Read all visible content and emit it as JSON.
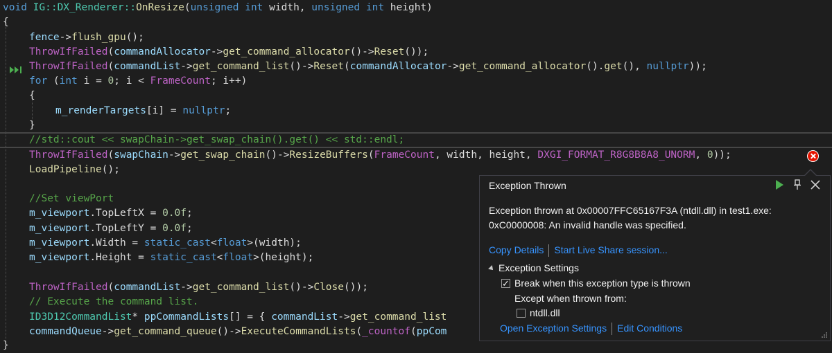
{
  "code": {
    "signature": {
      "kw_void": "void",
      "class": "IG::DX_Renderer::",
      "method": "OnResize",
      "open": "(",
      "kw_unsigned1": "unsigned",
      "kw_int1": "int",
      "p1": "width,",
      "kw_unsigned2": "unsigned",
      "kw_int2": "int",
      "p2": "height)"
    },
    "brace_open": "{",
    "l1": {
      "obj": "fence",
      "rest": "->",
      "fn": "flush_gpu",
      "tail": "();"
    },
    "l2": {
      "fn1": "ThrowIfFailed",
      "a": "(",
      "obj": "commandAllocator",
      "b": "->",
      "fn2": "get_command_allocator",
      "c": "()->",
      "fn3": "Reset",
      "d": "());"
    },
    "l3": {
      "fn1": "ThrowIfFailed",
      "a": "(",
      "obj": "commandList",
      "b": "->",
      "fn2": "get_command_list",
      "c": "()->",
      "fn3": "Reset",
      "d": "(",
      "obj2": "commandAllocator",
      "e": "->",
      "fn4": "get_command_allocator",
      "f": "().",
      "fn5": "get",
      "g": "(), ",
      "kw": "nullptr",
      "h": "));"
    },
    "l4": {
      "kw_for": "for",
      "a": " (",
      "kw_int": "int",
      "b": " i = ",
      "num": "0",
      "c": "; i < ",
      "macro": "FrameCount",
      "d": "; i++)"
    },
    "l5": "{",
    "l6": {
      "obj": "m_renderTargets",
      "a": "[i] = ",
      "kw": "nullptr",
      "b": ";"
    },
    "l7": "}",
    "l8": "//std::cout << swapChain->get_swap_chain().get() << std::endl;",
    "l9": {
      "fn1": "ThrowIfFailed",
      "a": "(",
      "obj": "swapChain",
      "b": "->",
      "fn2": "get_swap_chain",
      "c": "()->",
      "fn3": "ResizeBuffers",
      "d": "(",
      "macro": "FrameCount",
      "e": ", width, height, ",
      "enum": "DXGI_FORMAT_R8G8B8A8_UNORM",
      "f": ", ",
      "num": "0",
      "g": "));"
    },
    "l10": {
      "fn": "LoadPipeline",
      "a": "();"
    },
    "l11": "//Set viewPort",
    "l12": {
      "obj": "m_viewport",
      "a": ".",
      "mem": "TopLeftX",
      "b": " = ",
      "num": "0.0f",
      "c": ";"
    },
    "l13": {
      "obj": "m_viewport",
      "a": ".",
      "mem": "TopLeftY",
      "b": " = ",
      "num": "0.0f",
      "c": ";"
    },
    "l14": {
      "obj": "m_viewport",
      "a": ".",
      "mem": "Width",
      "b": " = ",
      "kw": "static_cast",
      "c": "<",
      "ty": "float",
      "d": ">(width);"
    },
    "l15": {
      "obj": "m_viewport",
      "a": ".",
      "mem": "Height",
      "b": " = ",
      "kw": "static_cast",
      "c": "<",
      "ty": "float",
      "d": ">(height);"
    },
    "l16": {
      "fn1": "ThrowIfFailed",
      "a": "(",
      "obj": "commandList",
      "b": "->",
      "fn2": "get_command_list",
      "c": "()->",
      "fn3": "Close",
      "d": "());"
    },
    "l17": "// Execute the command list.",
    "l18": {
      "ty": "ID3D12CommandList",
      "a": "* ",
      "var": "ppCommandLists",
      "b": "[] = { ",
      "obj": "commandList",
      "c": "->",
      "fn": "get_command_list"
    },
    "l19": {
      "obj": "commandQueue",
      "a": "->",
      "fn1": "get_command_queue",
      "b": "()->",
      "fn2": "ExecuteCommandLists",
      "c": "(",
      "macro": "_countof",
      "d": "(",
      "var": "ppCom"
    },
    "brace_close": "}"
  },
  "exception": {
    "title": "Exception Thrown",
    "message_line1": "Exception thrown at 0x00007FFC65167F3A (ntdll.dll) in test1.exe:",
    "message_line2": "0xC0000008: An invalid handle was specified.",
    "copy_details": "Copy Details",
    "live_share": "Start Live Share session...",
    "settings_header": "Exception Settings",
    "break_label": "Break when this exception type is thrown",
    "break_checked": true,
    "except_label": "Except when thrown from:",
    "ntdll_label": "ntdll.dll",
    "ntdll_checked": false,
    "open_settings": "Open Exception Settings",
    "edit_conditions": "Edit Conditions"
  },
  "icons": {
    "continue": "play-icon",
    "pin": "pin-icon",
    "close": "close-icon",
    "error": "error-icon",
    "current_statement": "current-statement-icon"
  },
  "colors": {
    "background": "#1e1e1e",
    "error": "#e51400",
    "link": "#3794ff",
    "continue_green": "#4caf50"
  }
}
